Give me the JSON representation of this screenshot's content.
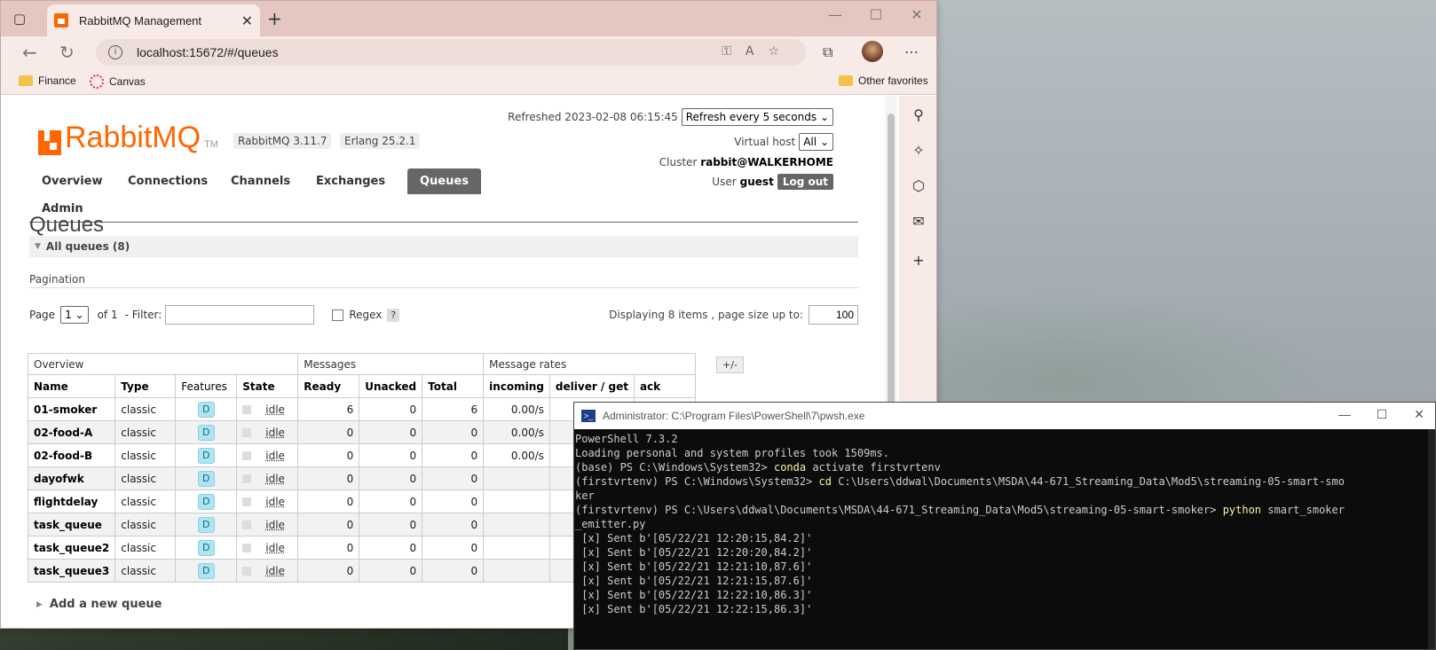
{
  "browser": {
    "tab_title": "RabbitMQ Management",
    "url": "localhost:15672/#/queues",
    "favorites": [
      "Finance",
      "Canvas"
    ],
    "other_favorites": "Other favorites"
  },
  "header": {
    "logo_text": "RabbitMQ",
    "logo_tm": "TM",
    "version": "RabbitMQ 3.11.7",
    "erlang": "Erlang 25.2.1",
    "refreshed_label": "Refreshed 2023-02-08 06:15:45",
    "refresh_select": "Refresh every 5 seconds",
    "vhost_label": "Virtual host",
    "vhost_value": "All",
    "cluster_label": "Cluster",
    "cluster_value": "rabbit@WALKERHOME",
    "user_label": "User",
    "user_value": "guest",
    "logout": "Log out"
  },
  "nav": {
    "tabs": [
      "Overview",
      "Connections",
      "Channels",
      "Exchanges",
      "Queues",
      "Admin"
    ],
    "active": "Queues"
  },
  "queues": {
    "title": "Queues",
    "all_queues": "All queues (8)",
    "pagination_label": "Pagination",
    "page_label": "Page",
    "page_value": "1",
    "of_label": "of 1",
    "filter_label": "- Filter:",
    "filter_value": "",
    "regex_label": "Regex",
    "help": "?",
    "displaying": "Displaying 8 items , page size up to:",
    "page_size": "100",
    "plus_minus": "+/-",
    "group_headers": [
      "Overview",
      "Messages",
      "Message rates"
    ],
    "columns": [
      "Name",
      "Type",
      "Features",
      "State",
      "Ready",
      "Unacked",
      "Total",
      "incoming",
      "deliver / get",
      "ack"
    ],
    "rows": [
      {
        "name": "01-smoker",
        "type": "classic",
        "feature": "D",
        "state": "idle",
        "ready": "6",
        "unacked": "0",
        "total": "6",
        "incoming": "0.00/s"
      },
      {
        "name": "02-food-A",
        "type": "classic",
        "feature": "D",
        "state": "idle",
        "ready": "0",
        "unacked": "0",
        "total": "0",
        "incoming": "0.00/s"
      },
      {
        "name": "02-food-B",
        "type": "classic",
        "feature": "D",
        "state": "idle",
        "ready": "0",
        "unacked": "0",
        "total": "0",
        "incoming": "0.00/s"
      },
      {
        "name": "dayofwk",
        "type": "classic",
        "feature": "D",
        "state": "idle",
        "ready": "0",
        "unacked": "0",
        "total": "0",
        "incoming": ""
      },
      {
        "name": "flightdelay",
        "type": "classic",
        "feature": "D",
        "state": "idle",
        "ready": "0",
        "unacked": "0",
        "total": "0",
        "incoming": ""
      },
      {
        "name": "task_queue",
        "type": "classic",
        "feature": "D",
        "state": "idle",
        "ready": "0",
        "unacked": "0",
        "total": "0",
        "incoming": ""
      },
      {
        "name": "task_queue2",
        "type": "classic",
        "feature": "D",
        "state": "idle",
        "ready": "0",
        "unacked": "0",
        "total": "0",
        "incoming": ""
      },
      {
        "name": "task_queue3",
        "type": "classic",
        "feature": "D",
        "state": "idle",
        "ready": "0",
        "unacked": "0",
        "total": "0",
        "incoming": ""
      }
    ],
    "add_queue": "Add a new queue"
  },
  "powershell": {
    "title": "Administrator: C:\\Program Files\\PowerShell\\7\\pwsh.exe",
    "lines": [
      {
        "text": "PowerShell 7.3.2"
      },
      {
        "text": "Loading personal and system profiles took 1509ms."
      },
      {
        "prompt": "(base) PS C:\\Windows\\System32> ",
        "cmd": "conda",
        "rest": " activate firstvrtenv"
      },
      {
        "prompt": "(firstvrtenv) PS C:\\Windows\\System32> ",
        "cmd": "cd",
        "rest": " C:\\Users\\ddwal\\Documents\\MSDA\\44-671_Streaming_Data\\Mod5\\streaming-05-smart-smo"
      },
      {
        "text": "ker"
      },
      {
        "prompt": "(firstvrtenv) PS C:\\Users\\ddwal\\Documents\\MSDA\\44-671_Streaming_Data\\Mod5\\streaming-05-smart-smoker> ",
        "cmd": "python",
        "rest": " smart_smoker"
      },
      {
        "text": "_emitter.py"
      },
      {
        "text": " [x] Sent b'[05/22/21 12:20:15,84.2]'"
      },
      {
        "text": " [x] Sent b'[05/22/21 12:20:20,84.2]'"
      },
      {
        "text": " [x] Sent b'[05/22/21 12:21:10,87.6]'"
      },
      {
        "text": " [x] Sent b'[05/22/21 12:21:15,87.6]'"
      },
      {
        "text": " [x] Sent b'[05/22/21 12:22:10,86.3]'"
      },
      {
        "text": " [x] Sent b'[05/22/21 12:22:15,86.3]'"
      }
    ]
  },
  "icons": {
    "tab_actions": "tab-actions-icon",
    "back": "back-arrow-icon",
    "reload": "reload-icon",
    "info": "info-icon",
    "key": "key-icon",
    "read_aloud": "read-aloud-icon",
    "favorite_add": "add-favorite-icon",
    "collections": "collections-icon",
    "menu": "more-icon"
  },
  "colors": {
    "brand": "#ff6600",
    "nav_active": "#666666",
    "badge": "#aee5f0",
    "terminal_bg": "#0c0c0c",
    "terminal_cmd": "#f9f1a5"
  }
}
